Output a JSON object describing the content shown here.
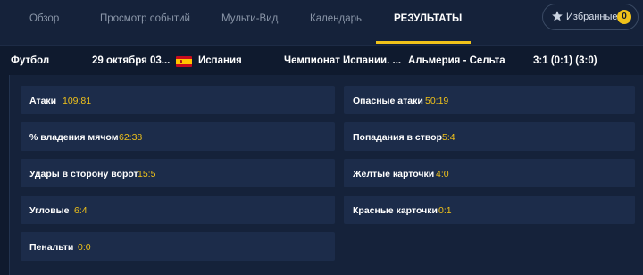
{
  "nav": {
    "tabs": [
      {
        "label": "Обзор"
      },
      {
        "label": "Просмотр событий"
      },
      {
        "label": "Мульти-Вид"
      },
      {
        "label": "Календарь"
      },
      {
        "label": "РЕЗУЛЬТАТЫ"
      }
    ],
    "active_tab": "РЕЗУЛЬТАТЫ",
    "favorites": {
      "label": "Избранные",
      "count": "0",
      "icon": "star-icon"
    }
  },
  "match": {
    "sport": "Футбол",
    "date": "29 октября 03...",
    "country": "Испания",
    "flag_icon": "spain-flag-icon",
    "league": "Чемпионат Испании. ...",
    "teams": "Альмерия - Сельта",
    "score": "3:1 (0:1) (3:0)"
  },
  "stats": {
    "left": [
      {
        "label": "Атаки",
        "value": "109:81"
      },
      {
        "label": "% владения мячом",
        "value": "62:38"
      },
      {
        "label": "Удары в сторону ворот",
        "value": "15:5"
      },
      {
        "label": "Угловые",
        "value": "6:4"
      },
      {
        "label": "Пенальти",
        "value": "0:0"
      }
    ],
    "right": [
      {
        "label": "Опасные атаки",
        "value": "50:19"
      },
      {
        "label": "Попадания в створ",
        "value": "5:4"
      },
      {
        "label": "Жёлтые карточки",
        "value": "4:0"
      },
      {
        "label": "Красные карточки",
        "value": "0:1"
      }
    ]
  },
  "colors": {
    "background": "#0f1a2e",
    "nav_bg": "#15223a",
    "cell_bg": "#1c2c4a",
    "accent": "#f0c21a",
    "muted_text": "#8a96a8"
  }
}
